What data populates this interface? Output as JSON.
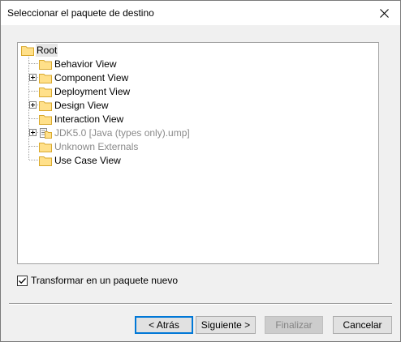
{
  "dialog": {
    "title": "Seleccionar el paquete de destino"
  },
  "tree": {
    "root": {
      "label": "Root",
      "selected": true
    },
    "items": [
      {
        "label": "Behavior View",
        "expandable": false,
        "disabled": false,
        "icon": "folder-icon"
      },
      {
        "label": "Component View",
        "expandable": true,
        "disabled": false,
        "icon": "folder-icon"
      },
      {
        "label": "Deployment View",
        "expandable": false,
        "disabled": false,
        "icon": "folder-icon"
      },
      {
        "label": "Design View",
        "expandable": true,
        "disabled": false,
        "icon": "folder-icon"
      },
      {
        "label": "Interaction View",
        "expandable": false,
        "disabled": false,
        "icon": "folder-icon"
      },
      {
        "label": "JDK5.0 [Java (types only).ump]",
        "expandable": true,
        "disabled": true,
        "icon": "library-package-icon"
      },
      {
        "label": "Unknown Externals",
        "expandable": false,
        "disabled": true,
        "icon": "folder-icon"
      },
      {
        "label": "Use Case View",
        "expandable": false,
        "disabled": false,
        "icon": "folder-icon"
      }
    ]
  },
  "options": {
    "transform_label": "Transformar en un paquete nuevo",
    "transform_checked": true
  },
  "buttons": {
    "back": "< Atrás",
    "next": "Siguiente >",
    "finish": "Finalizar",
    "cancel": "Cancelar"
  },
  "colors": {
    "folder_fill": "#ffe08a",
    "folder_edge": "#d9a92e",
    "disabled_text": "#8a8a8a",
    "default_button_border": "#0078d7"
  }
}
